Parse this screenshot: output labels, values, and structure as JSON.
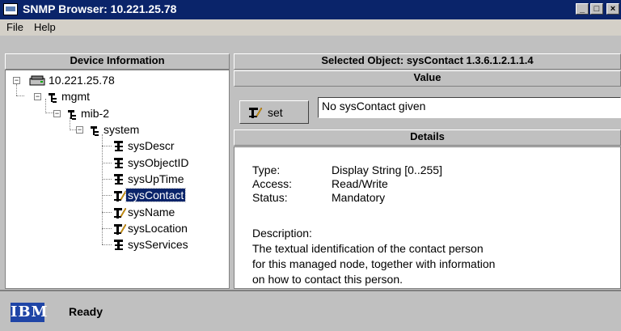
{
  "window": {
    "title": "SNMP Browser: 10.221.25.78",
    "buttons": {
      "minimize": "_",
      "maximize": "□",
      "close": "×"
    }
  },
  "menu": {
    "items": [
      "File",
      "Help"
    ]
  },
  "left_panel": {
    "header": "Device Information",
    "tree": {
      "root": "10.221.25.78",
      "nodes": [
        "mgmt",
        "mib-2",
        "system"
      ],
      "leaves": [
        "sysDescr",
        "sysObjectID",
        "sysUpTime",
        "sysContact",
        "sysName",
        "sysLocation",
        "sysServices"
      ],
      "selected": "sysContact"
    }
  },
  "right_panel": {
    "header": "Selected Object:  sysContact  1.3.6.1.2.1.1.4",
    "value_header": "Value",
    "set_label": "set",
    "value": "No sysContact given",
    "details_header": "Details",
    "details": {
      "type_label": "Type:",
      "type_value": "Display String [0..255]",
      "access_label": "Access:",
      "access_value": "Read/Write",
      "status_label": "Status:",
      "status_value": "Mandatory",
      "description_label": "Description:",
      "description_lines": [
        "The textual identification of the contact person",
        "for this managed node, together with information",
        "on how to contact this person."
      ]
    }
  },
  "statusbar": {
    "logo": "IBM",
    "text": "Ready"
  }
}
